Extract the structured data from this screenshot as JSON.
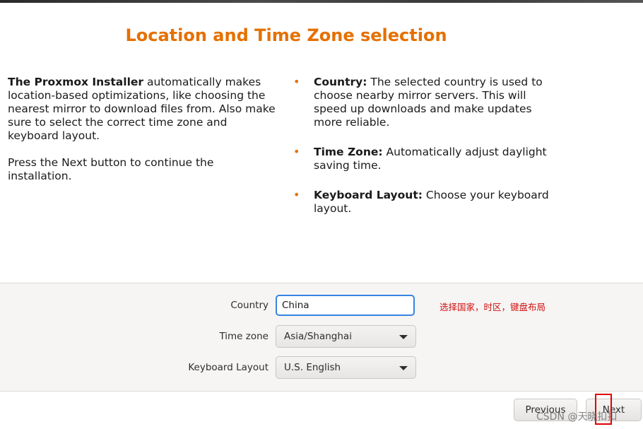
{
  "page": {
    "title": "Location and Time Zone selection"
  },
  "intro": {
    "paragraph1_bold": "The Proxmox Installer",
    "paragraph1_rest": " automatically makes location-based optimizations, like choosing the nearest mirror to download files from. Also make sure to select the correct time zone and keyboard layout.",
    "paragraph2": "Press the Next button to continue the installation."
  },
  "bullets": [
    {
      "term": "Country:",
      "text": " The selected country is used to choose nearby mirror servers. This will speed up downloads and make updates more reliable."
    },
    {
      "term": "Time Zone:",
      "text": " Automatically adjust daylight saving time."
    },
    {
      "term": "Keyboard Layout:",
      "text": " Choose your keyboard layout."
    }
  ],
  "form": {
    "country_label": "Country",
    "country_value": "China",
    "timezone_label": "Time zone",
    "timezone_value": "Asia/Shanghai",
    "keyboard_label": "Keyboard Layout",
    "keyboard_value": "U.S. English"
  },
  "annotation": "选择国家，时区，键盘布局",
  "buttons": {
    "previous": "Previous",
    "next": "Next"
  },
  "watermark": "CSDN @天晓扣扣",
  "colors": {
    "accent": "#e57000",
    "focus": "#3584e4",
    "annotation": "#d01010"
  }
}
